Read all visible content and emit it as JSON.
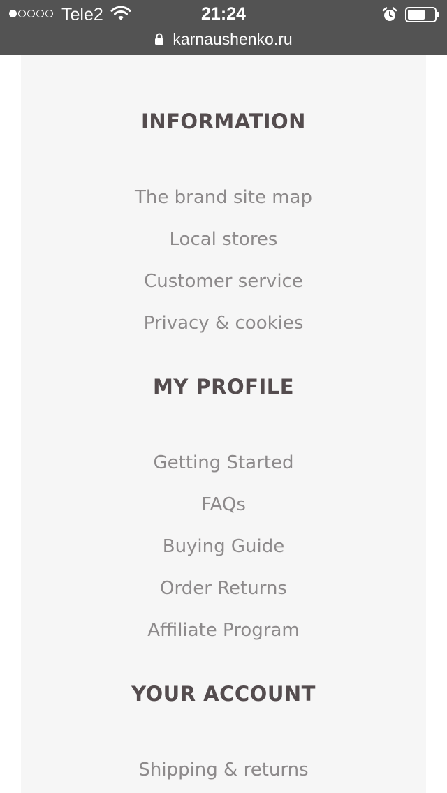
{
  "status_bar": {
    "carrier": "Tele2",
    "time": "21:24",
    "signal_bars_filled": 1,
    "signal_bars_total": 5,
    "battery_level": 0.65,
    "icons": [
      "wifi-icon",
      "alarm-icon",
      "battery-icon",
      "lock-icon"
    ]
  },
  "address_bar": {
    "url": "karnaushenko.ru"
  },
  "footer": {
    "sections": [
      {
        "title": "INFORMATION",
        "links": [
          "The brand site map",
          "Local stores",
          "Customer service",
          "Privacy & cookies"
        ]
      },
      {
        "title": "MY PROFILE",
        "links": [
          "Getting Started",
          "FAQs",
          "Buying Guide",
          "Order Returns",
          "Affiliate Program"
        ]
      },
      {
        "title": "YOUR ACCOUNT",
        "links": [
          "Shipping & returns"
        ]
      }
    ]
  },
  "colors": {
    "status_bar_bg": "#535353",
    "panel_bg": "#f6f6f6",
    "heading": "#544c4e",
    "link": "#8d8a8b"
  }
}
